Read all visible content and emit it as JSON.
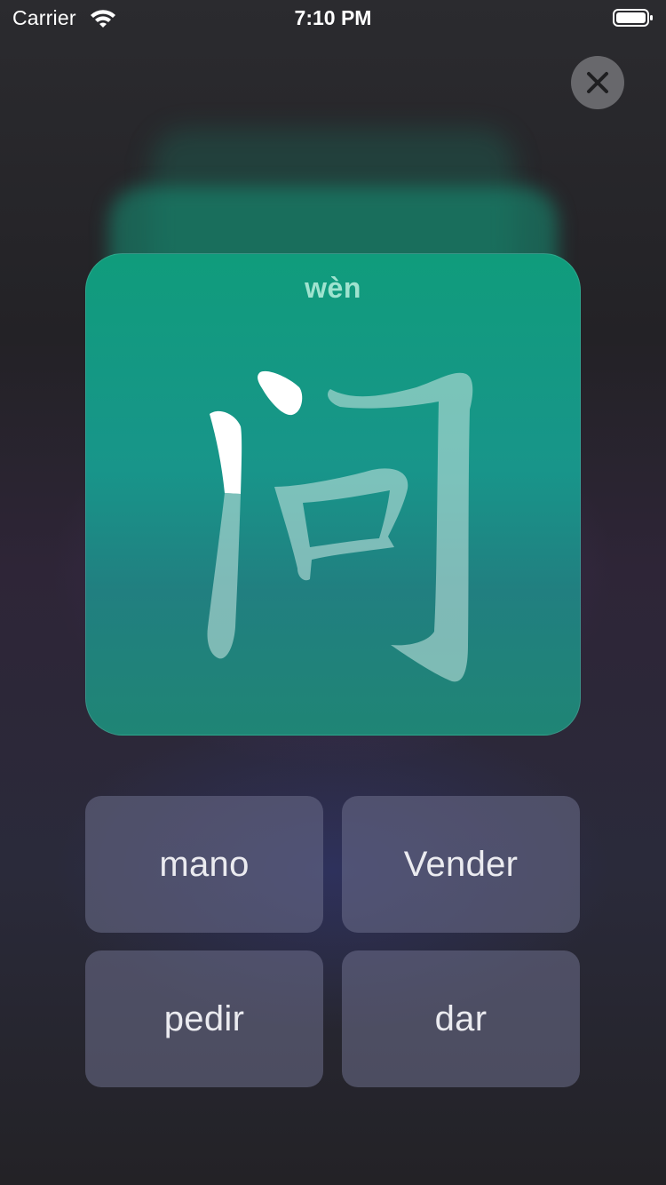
{
  "status_bar": {
    "carrier": "Carrier",
    "time": "7:10 PM"
  },
  "close_button": {
    "icon": "close-icon"
  },
  "flashcard": {
    "pinyin": "wèn",
    "character": "问",
    "stroke_progress": "1 of 3 strokes highlighted"
  },
  "answers": {
    "options": [
      "mano",
      "Vender",
      "pedir",
      "dar"
    ]
  },
  "colors": {
    "card_teal": "#109c7c",
    "pinyin": "#9fe3cf",
    "highlight_stroke": "#ffffff"
  }
}
